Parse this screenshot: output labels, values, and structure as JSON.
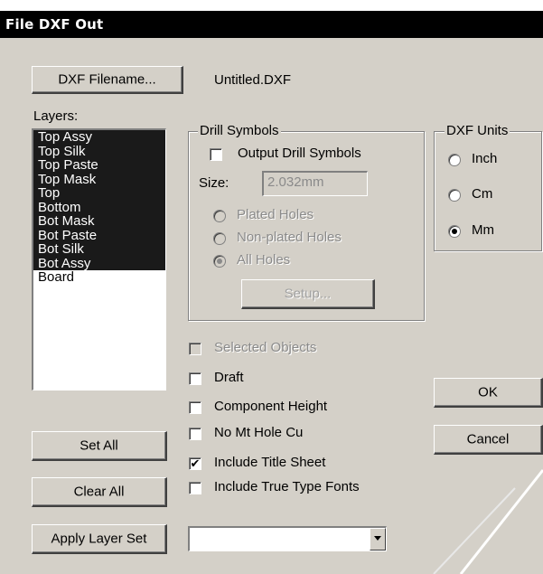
{
  "window": {
    "title": "File DXF Out"
  },
  "filename": {
    "button_label": "DXF Filename...",
    "value": "Untitled.DXF"
  },
  "layers": {
    "label": "Layers:",
    "items": [
      "Top Assy",
      "Top Silk",
      "Top Paste",
      "Top Mask",
      "Top",
      "Bottom",
      "Bot Mask",
      "Bot Paste",
      "Bot Silk",
      "Bot Assy",
      "Board"
    ],
    "selected_count": 10
  },
  "drill": {
    "group_label": "Drill Symbols",
    "output_label": "Output Drill Symbols",
    "output_checked": false,
    "size_label": "Size:",
    "size_value": "2.032mm",
    "plated_label": "Plated Holes",
    "nonplated_label": "Non-plated Holes",
    "all_label": "All Holes",
    "selected_option": "All Holes",
    "setup_label": "Setup..."
  },
  "units": {
    "group_label": "DXF Units",
    "inch_label": "Inch",
    "cm_label": "Cm",
    "mm_label": "Mm",
    "selected": "Mm"
  },
  "options": {
    "selected_objects": {
      "label": "Selected Objects",
      "checked": false,
      "enabled": false
    },
    "draft": {
      "label": "Draft",
      "checked": false
    },
    "component_height": {
      "label": "Component Height",
      "checked": false
    },
    "no_mt_hole_cu": {
      "label": "No Mt Hole Cu",
      "checked": false
    },
    "include_title_sheet": {
      "label": "Include Title Sheet",
      "checked": true
    },
    "include_true_type_fonts": {
      "label": "Include True Type Fonts",
      "checked": false
    }
  },
  "buttons": {
    "ok": "OK",
    "cancel": "Cancel",
    "set_all": "Set All",
    "clear_all": "Clear All",
    "apply_layer_set": "Apply Layer Set"
  },
  "layer_set_combo": {
    "value": ""
  },
  "check_mark": "✔",
  "colors": {
    "dialog_bg": "#d4d0c8",
    "title_bg": "#000000",
    "selection_bg": "#1a1a1a"
  }
}
